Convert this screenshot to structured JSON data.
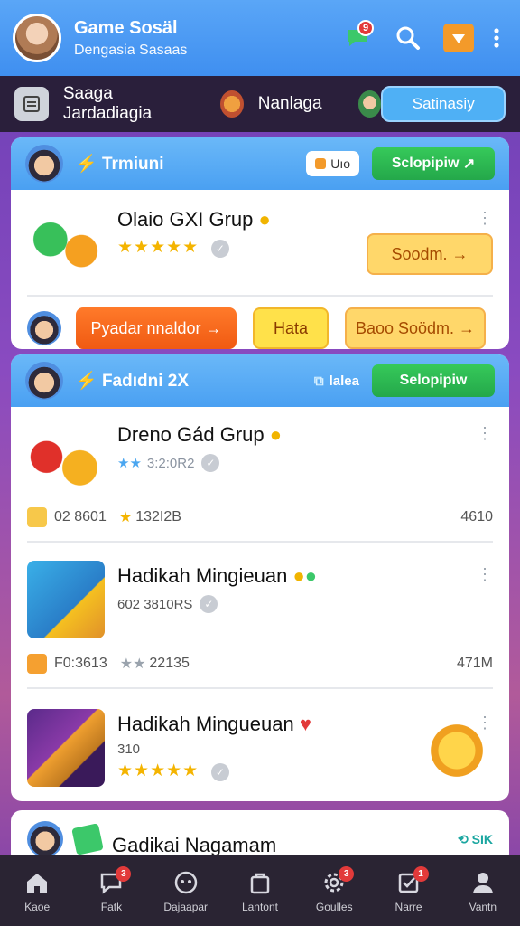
{
  "header": {
    "title": "Game Sosäl",
    "subtitle": "Dengasia Sasaas",
    "chat_badge": "9"
  },
  "category_bar": {
    "label1": "Saaga Jardadiagia",
    "label2": "Nanlaga",
    "button": "Satinasiy"
  },
  "card1": {
    "header_title": "Trmiuni",
    "header_chip": "Uıo",
    "join_label": "Sclopipiw",
    "item": {
      "title": "Olaio GXI Grup",
      "stars": "★★★★★"
    },
    "action_button": "Soodm.",
    "footer_buttons": [
      "Pyadar nnaldor",
      "Hata",
      "Baoo Soödm."
    ]
  },
  "card2": {
    "header_title": "Fadıdni 2X",
    "header_chip": "lalea",
    "join_label": "Selopipiw",
    "items": [
      {
        "title": "Dreno Gád Grup",
        "stars_small": "★★",
        "meta": "3:2:0R2",
        "row_left": "02 8601",
        "row_mid": "132I2B",
        "row_right": "4610"
      },
      {
        "title": "Hadikah Mingieuan",
        "meta": "602 3810RS",
        "row_left": "F0:3613",
        "row_mid": "22135",
        "row_right": "471M"
      },
      {
        "title": "Hadikah Mingueuan",
        "meta": "310",
        "stars": "★★★★★"
      }
    ]
  },
  "card3": {
    "title": "Gadikai Nagamam",
    "chip": "SIK"
  },
  "bottom_nav": [
    {
      "label": "Kaoe"
    },
    {
      "label": "Fatk",
      "badge": "3"
    },
    {
      "label": "Dajaapar"
    },
    {
      "label": "Lantont"
    },
    {
      "label": "Goulles",
      "badge": "3"
    },
    {
      "label": "Narre",
      "badge": "1"
    },
    {
      "label": "Vantn"
    }
  ]
}
